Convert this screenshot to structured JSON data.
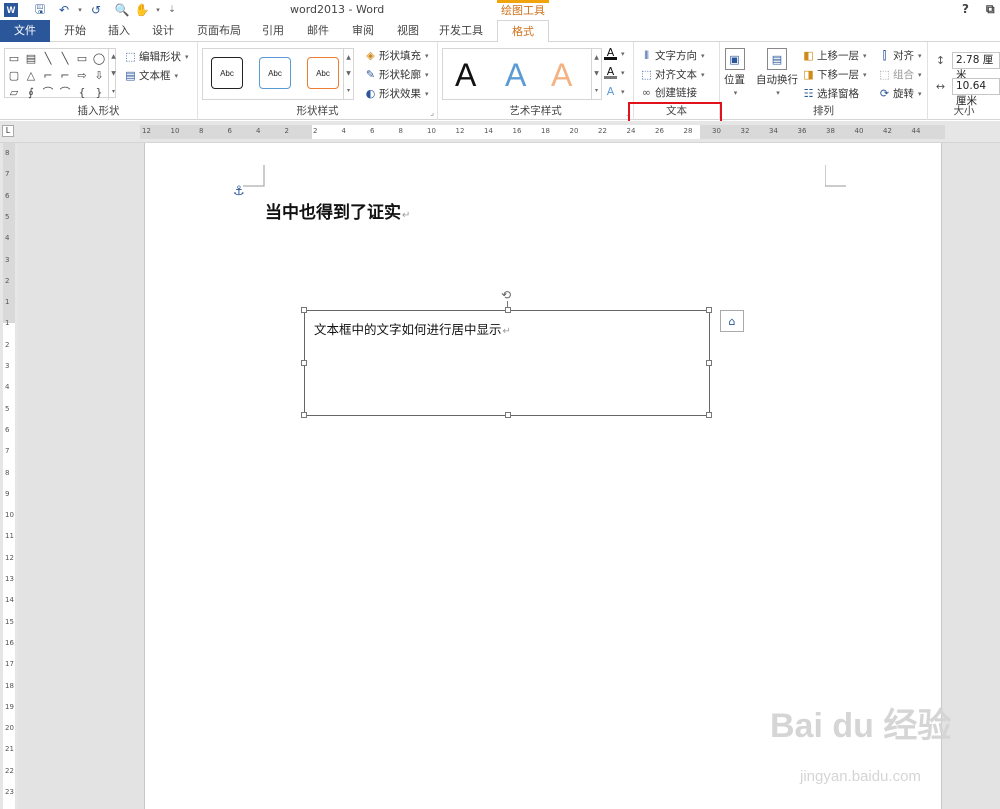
{
  "window": {
    "title": "word2013 - Word",
    "context_label": "绘图工具",
    "help": "?",
    "restore": "⧉"
  },
  "qat": {
    "word_logo": "W",
    "save": "🖫",
    "undo": "↶",
    "redo": "↺",
    "print_preview": "🔍",
    "touch": "✋",
    "more": "⇣"
  },
  "tabs": [
    "文件",
    "开始",
    "插入",
    "设计",
    "页面布局",
    "引用",
    "邮件",
    "审阅",
    "视图",
    "开发工具",
    "格式"
  ],
  "ribbon": {
    "insert_shapes": {
      "label": "插入形状",
      "edit_shape": "编辑形状",
      "text_box": "文本框",
      "shapes": [
        "▭",
        "▤",
        "╲",
        "╲",
        "▭",
        "◯",
        "▢",
        "△",
        "⌐",
        "⌐",
        "⇨",
        "⇩",
        "▱",
        "∮",
        "⌒",
        "⌒",
        "{",
        "}"
      ]
    },
    "shape_styles": {
      "label": "形状样式",
      "samples": [
        "Abc",
        "Abc",
        "Abc"
      ],
      "sample_colors": [
        "#222222",
        "#5b9bd5",
        "#ed7d31"
      ],
      "fill": "形状填充",
      "outline": "形状轮廓",
      "effects": "形状效果"
    },
    "wordart": {
      "label": "艺术字样式",
      "samples": [
        "A",
        "A",
        "A"
      ],
      "sample_colors": [
        "#111111",
        "#5b9bd5",
        "#f4b183"
      ]
    },
    "text": {
      "label": "文本",
      "direction": "文字方向",
      "align": "对齐文本",
      "link": "创建链接"
    },
    "arrange": {
      "label": "排列",
      "position": "位置",
      "wrap": "自动换行",
      "bring_forward": "上移一层",
      "send_backward": "下移一层",
      "selection_pane": "选择窗格",
      "align": "对齐",
      "group": "组合",
      "rotate": "旋转"
    },
    "size": {
      "label": "大小",
      "height": "2.78 厘米",
      "width": "10.64 厘米"
    }
  },
  "ruler": {
    "corner": "L",
    "h_ticks": [
      "12",
      "10",
      "8",
      "6",
      "4",
      "2",
      "2",
      "4",
      "6",
      "8",
      "10",
      "12",
      "14",
      "16",
      "18",
      "20",
      "22",
      "24",
      "26",
      "28",
      "30",
      "32",
      "34",
      "36",
      "38",
      "40",
      "42",
      "44"
    ],
    "v_ticks": [
      "8",
      "7",
      "6",
      "5",
      "4",
      "3",
      "2",
      "1",
      "1",
      "2",
      "3",
      "4",
      "5",
      "6",
      "7",
      "8",
      "9",
      "10",
      "11",
      "12",
      "13",
      "14",
      "15",
      "16",
      "17",
      "18",
      "19",
      "20",
      "21",
      "22",
      "23"
    ]
  },
  "document": {
    "heading": "当中也得到了证实",
    "para_mark": "↵",
    "anchor": "⚓",
    "textbox_text": "文本框中的文字如何进行居中显示",
    "rotate": "⟲",
    "layout_icon": "⌂"
  },
  "watermark": {
    "brand": "Bai du 经验",
    "url": "jingyan.baidu.com"
  }
}
